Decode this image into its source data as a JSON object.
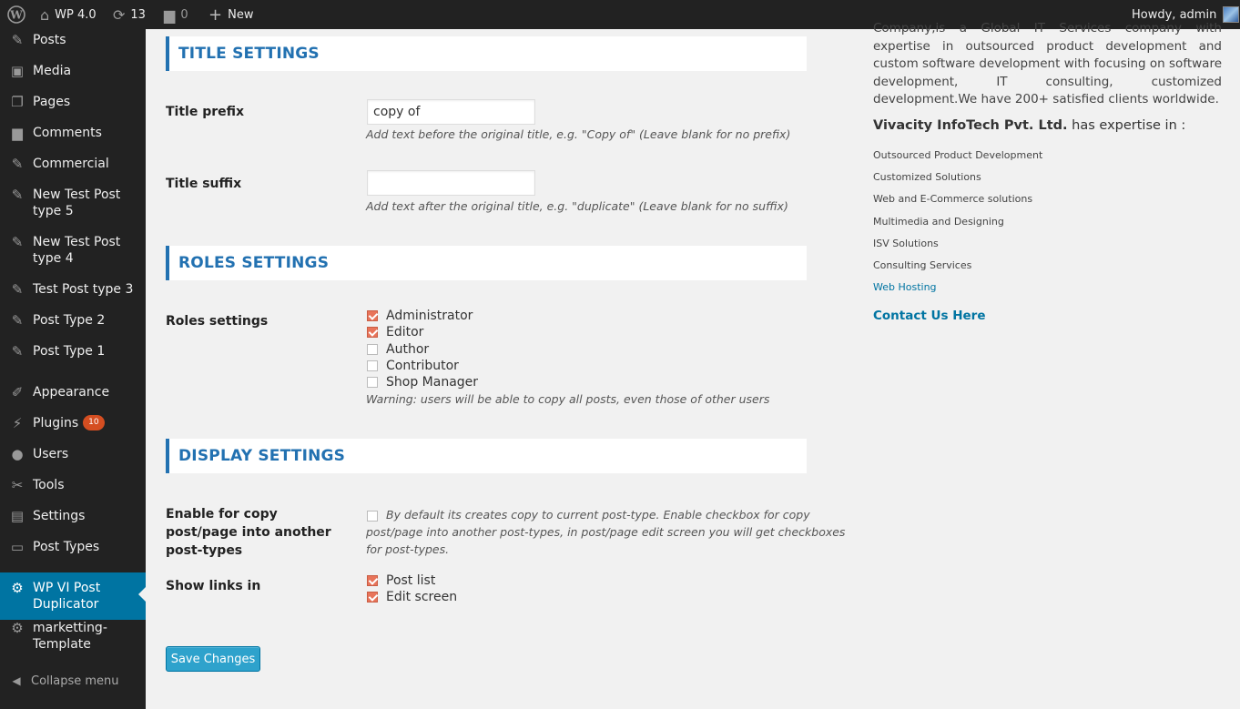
{
  "admin_bar": {
    "site_name": "WP 4.0",
    "updates_count": "13",
    "comments_count": "0",
    "new_label": "New",
    "greeting": "Howdy, admin"
  },
  "sidebar": {
    "items": [
      {
        "label": "Posts",
        "icon": "pin-icon"
      },
      {
        "label": "Media",
        "icon": "media-icon"
      },
      {
        "label": "Pages",
        "icon": "pages-icon"
      },
      {
        "label": "Comments",
        "icon": "comment-icon"
      },
      {
        "label": "Commercial",
        "icon": "pin-icon"
      },
      {
        "label": "New Test Post type 5",
        "icon": "pin-icon"
      },
      {
        "label": "New Test Post type 4",
        "icon": "pin-icon"
      },
      {
        "label": "Test Post type 3",
        "icon": "pin-icon"
      },
      {
        "label": "Post Type 2",
        "icon": "pin-icon"
      },
      {
        "label": "Post Type 1",
        "icon": "pin-icon"
      },
      {
        "label": "Appearance",
        "icon": "brush-icon"
      },
      {
        "label": "Plugins",
        "icon": "plug-icon",
        "badge": "10"
      },
      {
        "label": "Users",
        "icon": "user-icon"
      },
      {
        "label": "Tools",
        "icon": "wrench-icon"
      },
      {
        "label": "Settings",
        "icon": "sliders-icon"
      },
      {
        "label": "Post Types",
        "icon": "screen-icon"
      },
      {
        "label": "WP VI Post Duplicator",
        "icon": "gear-icon",
        "current": true
      },
      {
        "label": "marketting-Template",
        "icon": "gear-icon"
      }
    ],
    "collapse_label": "Collapse menu"
  },
  "title_settings": {
    "header": "TITLE SETTINGS",
    "prefix_label": "Title prefix",
    "prefix_value": "copy of",
    "prefix_desc": "Add text before the original title, e.g. \"Copy of\" (Leave blank for no prefix)",
    "suffix_label": "Title suffix",
    "suffix_value": "",
    "suffix_desc": "Add text after the original title, e.g. \"duplicate\" (Leave blank for no suffix)"
  },
  "roles_settings": {
    "header": "ROLES SETTINGS",
    "label": "Roles settings",
    "roles": [
      {
        "label": "Administrator",
        "checked": true
      },
      {
        "label": "Editor",
        "checked": true
      },
      {
        "label": "Author",
        "checked": false
      },
      {
        "label": "Contributor",
        "checked": false
      },
      {
        "label": "Shop Manager",
        "checked": false
      }
    ],
    "warning": "Warning: users will be able to copy all posts, even those of other users"
  },
  "display_settings": {
    "header": "DISPLAY SETTINGS",
    "enable_label": "Enable for copy post/page into another post-types",
    "enable_checked": false,
    "enable_desc": "By default its creates copy to current post-type. Enable checkbox for copy post/page into another post-types, in post/page edit screen you will get checkboxes for post-types.",
    "show_links_label": "Show links in",
    "show_links": [
      {
        "label": "Post list",
        "checked": true
      },
      {
        "label": "Edit screen",
        "checked": true
      }
    ]
  },
  "save_button": "Save Changes",
  "about": {
    "intro": "Company,is a Global IT Services company with expertise in outsourced product development and custom software development with focusing on software development, IT consulting, customized development.We have 200+ satisfied clients worldwide.",
    "company_name": "Vivacity InfoTech Pvt. Ltd.",
    "expertise_text": " has expertise in :",
    "services": [
      "Outsourced Product Development",
      "Customized Solutions",
      "Web and E-Commerce solutions",
      "Multimedia and Designing",
      "ISV Solutions",
      "Consulting Services",
      "Web Hosting"
    ],
    "contact_label": "Contact Us Here"
  },
  "colors": {
    "accent": "#2271b1",
    "sidebar_bg": "#222222",
    "current_menu": "#0074a2",
    "checkbox_checked": "#e8745a",
    "button": "#2ea2cc"
  }
}
